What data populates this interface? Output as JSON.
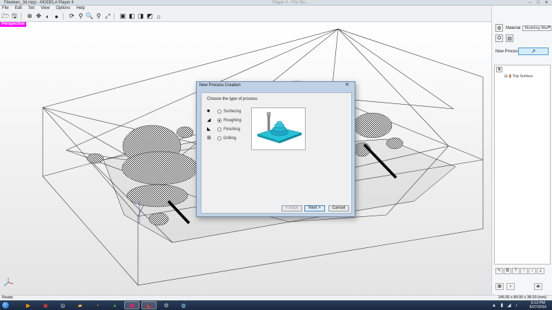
{
  "window": {
    "title": "Fleeteen_3d.mpp - MODELA Player 4",
    "ghost_title": "Player 4 - File Stc..."
  },
  "menu": [
    "File",
    "Edit",
    "Set",
    "View",
    "Options",
    "Help"
  ],
  "toolbar_icons": [
    "open-icon",
    "save-icon",
    "fit-icon",
    "zoom-icon",
    "pan-icon",
    "rotate-icon",
    "zoom-in-icon",
    "zoom-window-icon",
    "zoom-out-icon",
    "view-front-icon",
    "view-top-icon",
    "view-right-icon",
    "view-iso-icon",
    "view-home-icon"
  ],
  "viewport": {
    "view_label": "Perspective"
  },
  "dialog": {
    "title": "New Process Creation",
    "prompt": "Choose the type of process",
    "options": [
      {
        "label": "Surfacing",
        "selected": false
      },
      {
        "label": "Roughing",
        "selected": true
      },
      {
        "label": "Finishing",
        "selected": false
      },
      {
        "label": "Drilling",
        "selected": false
      }
    ],
    "back_label": "< Back",
    "next_label": "Next >",
    "cancel_label": "Cancel",
    "preview_colors": {
      "base": "#27c3d9",
      "dome": "#1fa5c2",
      "tool": "#888888"
    }
  },
  "panel": {
    "material_label": "Material",
    "material_value": "Modeling Wax",
    "new_process_label": "New Process",
    "tree_item": "Top Surface"
  },
  "status": {
    "ready": "Ready",
    "dimensions": "145.00 x 89.00 x 38.00 (mm)"
  },
  "taskbar": {
    "time": "5:13 PM",
    "date": "6/27/2016"
  },
  "colors": {
    "view_label_bg": "#ff00ff",
    "accent": "#4a9bd4"
  }
}
